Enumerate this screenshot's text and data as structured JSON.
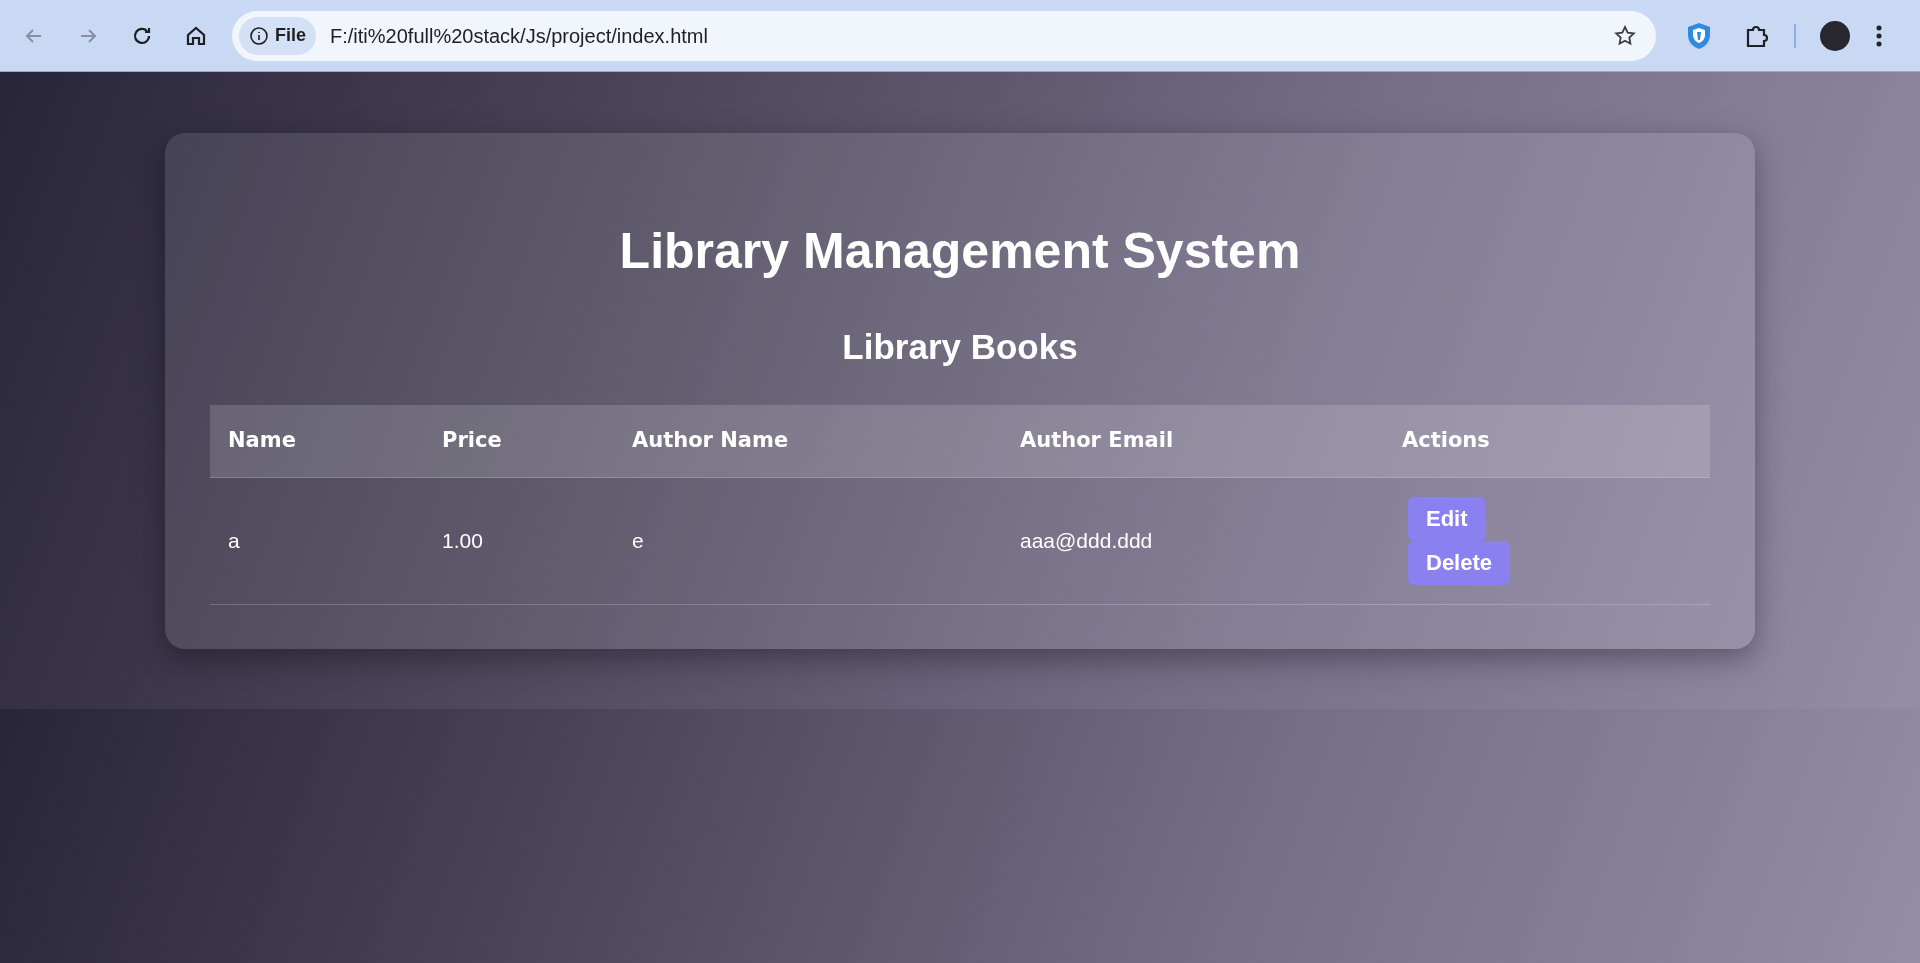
{
  "browser": {
    "site_chip": "File",
    "url": "F:/iti%20full%20stack/Js/project/index.html"
  },
  "page": {
    "title": "Library Management System",
    "subtitle": "Library Books"
  },
  "table": {
    "columns": [
      "Name",
      "Price",
      "Author Name",
      "Author Email",
      "Actions"
    ],
    "rows": [
      {
        "cells": [
          "a",
          "1.00",
          "e",
          "aaa@ddd.ddd"
        ],
        "actions": [
          "Edit",
          "Delete"
        ]
      }
    ]
  }
}
